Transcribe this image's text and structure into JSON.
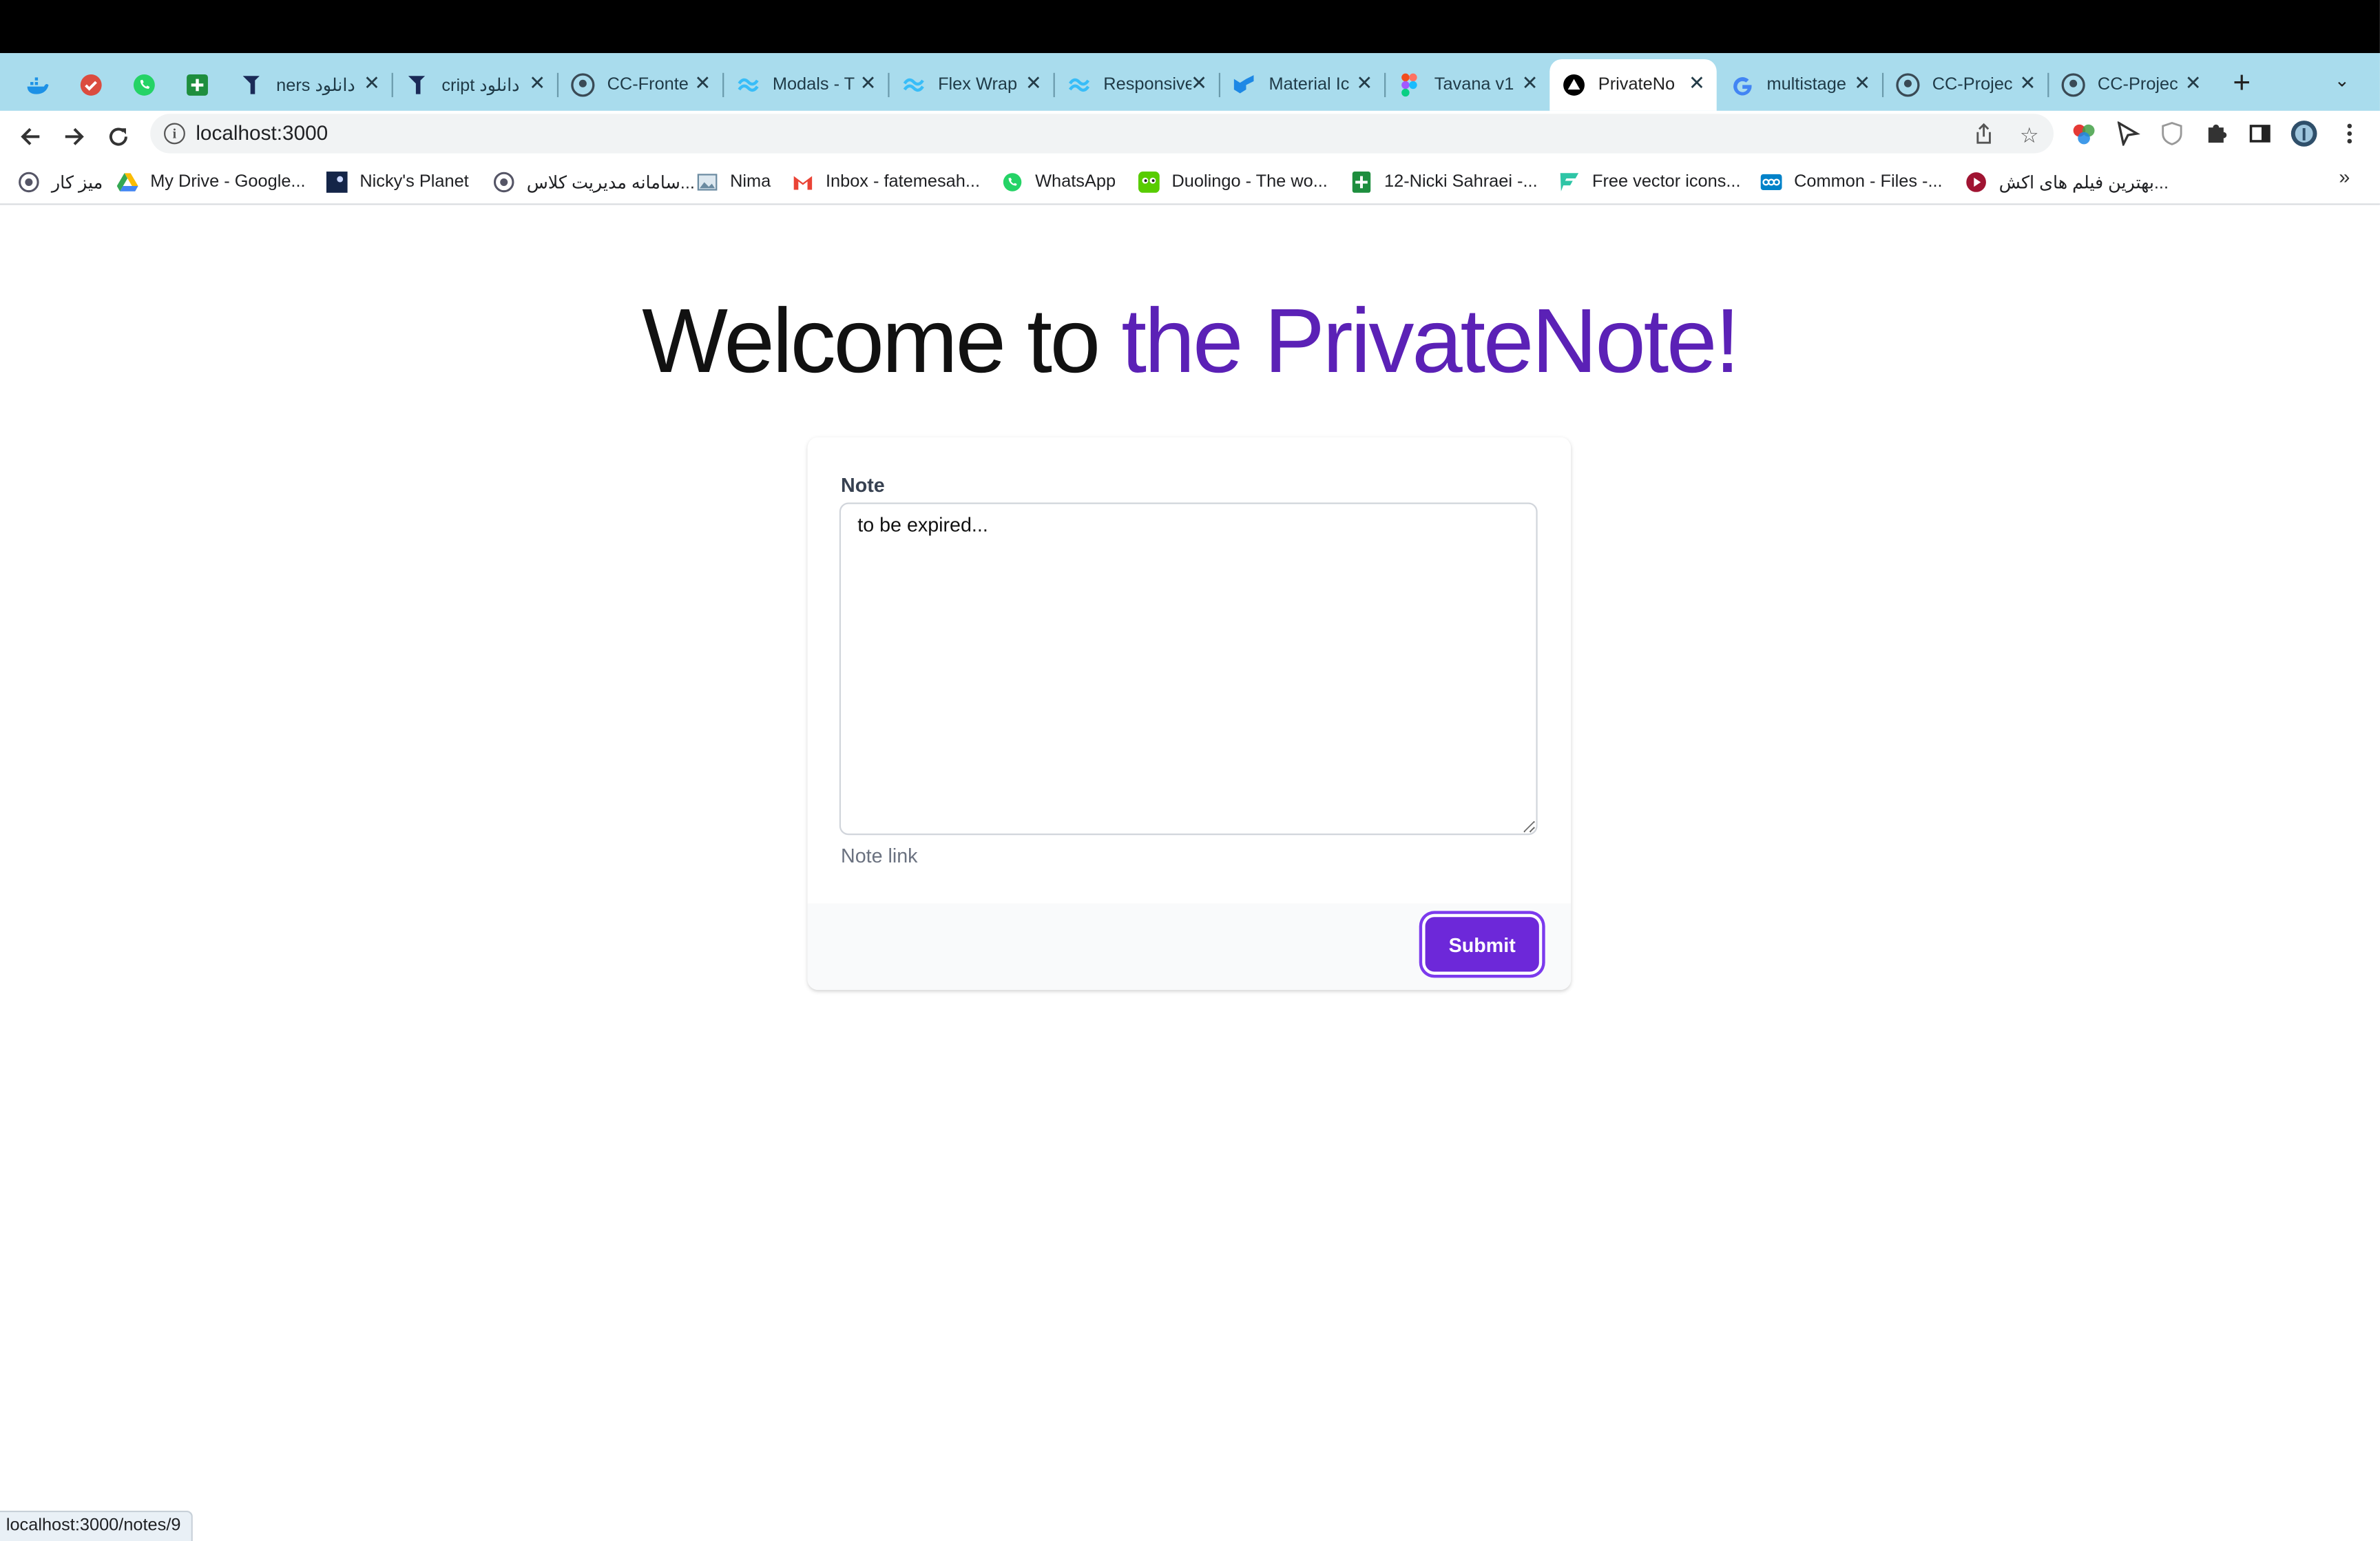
{
  "browser": {
    "pinned_tabs": [
      {
        "icon": "docker-whale-icon"
      },
      {
        "icon": "todoist-check-icon"
      },
      {
        "icon": "whatsapp-icon"
      },
      {
        "icon": "google-sheets-icon"
      }
    ],
    "tabs": [
      {
        "title": "ners دانلود",
        "icon": "site-logo-icon"
      },
      {
        "title": "cript دانلود",
        "icon": "site-logo-icon"
      },
      {
        "title": "CC-Fronte",
        "icon": "github-icon"
      },
      {
        "title": "Modals - T",
        "icon": "tailwind-icon"
      },
      {
        "title": "Flex Wrap",
        "icon": "tailwind-icon"
      },
      {
        "title": "Responsive",
        "icon": "tailwind-icon"
      },
      {
        "title": "Material Ic",
        "icon": "material-ui-icon"
      },
      {
        "title": "Tavana v1",
        "icon": "figma-icon"
      },
      {
        "title": "PrivateNo",
        "icon": "nextjs-icon",
        "active": true
      },
      {
        "title": "multistage",
        "icon": "google-icon"
      },
      {
        "title": "CC-Projec",
        "icon": "github-icon"
      },
      {
        "title": "CC-Projec",
        "icon": "github-icon"
      }
    ],
    "address_bar": {
      "url": "localhost:3000"
    },
    "bookmarks": [
      {
        "label": "میز کار",
        "icon": "university-logo-icon"
      },
      {
        "label": "My Drive - Google...",
        "icon": "google-drive-icon"
      },
      {
        "label": "Nicky's Planet",
        "icon": "planet-icon"
      },
      {
        "label": "سامانه مدیریت کلاس...",
        "icon": "university-logo-icon"
      },
      {
        "label": "Nima",
        "icon": "image-icon"
      },
      {
        "label": "Inbox - fatemesah...",
        "icon": "gmail-icon"
      },
      {
        "label": "WhatsApp",
        "icon": "whatsapp-icon"
      },
      {
        "label": "Duolingo - The wo...",
        "icon": "duolingo-icon"
      },
      {
        "label": "12-Nicki Sahraei -...",
        "icon": "google-sheets-icon"
      },
      {
        "label": "Free vector icons...",
        "icon": "flaticon-icon"
      },
      {
        "label": "Common - Files -...",
        "icon": "nextcloud-icon"
      },
      {
        "label": "بهترین فیلم های اکش...",
        "icon": "play-icon"
      }
    ],
    "more_bookmarks": "»",
    "status_url": "localhost:3000/notes/9"
  },
  "page": {
    "heading_prefix": "Welcome to ",
    "heading_accent": "the PrivateNote!",
    "accent_color": "#5b21b6",
    "note_label": "Note",
    "note_value": "to be expired...",
    "note_link_label": "Note link",
    "submit_label": "Submit",
    "button_color": "#6d28d9"
  }
}
